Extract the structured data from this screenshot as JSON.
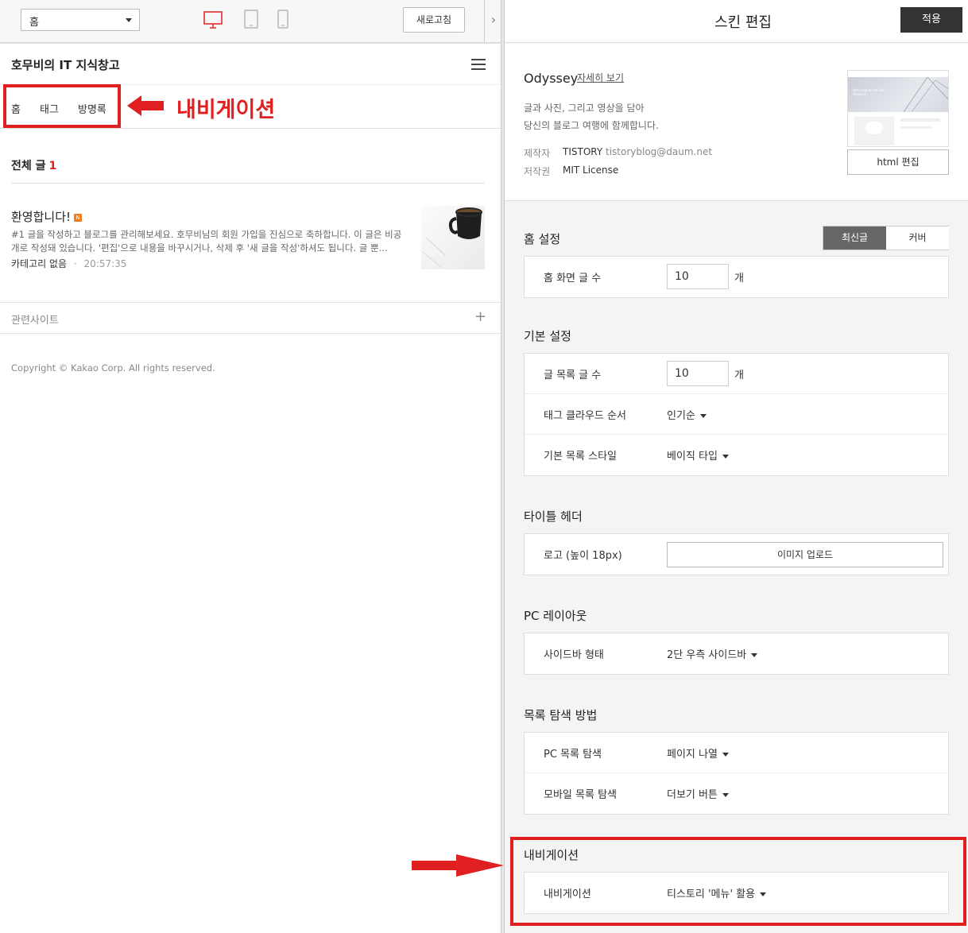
{
  "preview_toolbar": {
    "page_select": "홈",
    "refresh_label": "새로고침",
    "devices": [
      "pc-icon",
      "tablet-icon",
      "mobile-icon"
    ]
  },
  "blog": {
    "title": "호무비의 IT 지식창고",
    "nav": [
      "홈",
      "태그",
      "방명록"
    ],
    "annotation": "내비게이션",
    "all_posts_label": "전체 글",
    "all_posts_count": "1",
    "post": {
      "title": "환영합니다!",
      "badge": "N",
      "excerpt": "#1 글을 작성하고 블로그를 관리해보세요. 호무비님의 회원 가입을 진심으로 축하합니다. 이 글은 비공개로 작성돼 있습니다. '편집'으로 내용을 바꾸시거나, 삭제 후 '새 글을 작성'하셔도 됩니다. 글 뿐...",
      "category": "카테고리 없음",
      "separator": "·",
      "time": "20:57:35"
    },
    "related_sites": "관련사이트",
    "plus": "+",
    "copyright": "Copyright © Kakao Corp. All rights reserved."
  },
  "editor": {
    "title": "스킨 편집",
    "apply_label": "적용",
    "skin": {
      "name": "Odyssey",
      "detail_link": "자세히 보기",
      "desc1": "글과 사진, 그리고 영상을 담아",
      "desc2": "당신의 블로그 여행에 함께합니다.",
      "maker_label": "제작자",
      "maker_value": "TISTORY",
      "maker_email": "tistoryblog@daum.net",
      "license_label": "저작권",
      "license_value": "MIT License",
      "preview_text": "Welcome to the 1st Odyssey",
      "html_edit": "html 편집"
    },
    "home": {
      "title": "홈 설정",
      "toggle_on": "최신글",
      "toggle_off": "커버",
      "rows": [
        {
          "label": "홈 화면 글 수",
          "value": "10",
          "unit": "개"
        }
      ]
    },
    "basic": {
      "title": "기본 설정",
      "count_label": "글 목록 글 수",
      "count_value": "10",
      "count_unit": "개",
      "tag_label": "태그 클라우드 순서",
      "tag_value": "인기순",
      "style_label": "기본 목록 스타일",
      "style_value": "베이직 타입"
    },
    "title_header": {
      "title": "타이틀 헤더",
      "logo_label": "로고 (높이 18px)",
      "upload_label": "이미지 업로드"
    },
    "pc_layout": {
      "title": "PC 레이아웃",
      "sidebar_label": "사이드바 형태",
      "sidebar_value": "2단 우측 사이드바"
    },
    "list_nav": {
      "title": "목록 탐색 방법",
      "pc_label": "PC 목록 탐색",
      "pc_value": "페이지 나열",
      "mobile_label": "모바일 목록 탐색",
      "mobile_value": "더보기 버튼"
    },
    "navigation": {
      "title": "내비게이션",
      "label": "내비게이션",
      "value": "티스토리 '메뉴' 활용"
    }
  },
  "colors": {
    "accent_red": "#e02020",
    "dark_button": "#333333",
    "toggle_active": "#666666"
  }
}
